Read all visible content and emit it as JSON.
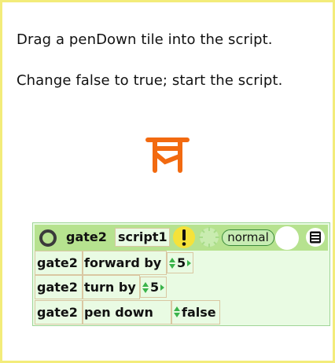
{
  "instructions": {
    "line1": "Drag a penDown tile into the script.",
    "line2": "Change false to true; start the script."
  },
  "script": {
    "header": {
      "object_name": "gate2",
      "script_name": "script1",
      "status": "normal",
      "icons": [
        "stop-circle-icon",
        "exclamation-icon",
        "clock-icon",
        "menu-icon"
      ]
    },
    "rows": [
      {
        "object": "gate2",
        "command": "forward by",
        "value": "5"
      },
      {
        "object": "gate2",
        "command": "turn by",
        "value": "5"
      },
      {
        "object": "gate2",
        "command": "pen down",
        "value": "false"
      }
    ]
  },
  "colors": {
    "frame_border": "#f3ec7a",
    "gate_orange": "#f26a10",
    "header_green": "#b6e28f",
    "panel_bg": "#e9fbe3",
    "arrow_green": "#3ab34a",
    "tick_yellow": "#f5e23a"
  }
}
